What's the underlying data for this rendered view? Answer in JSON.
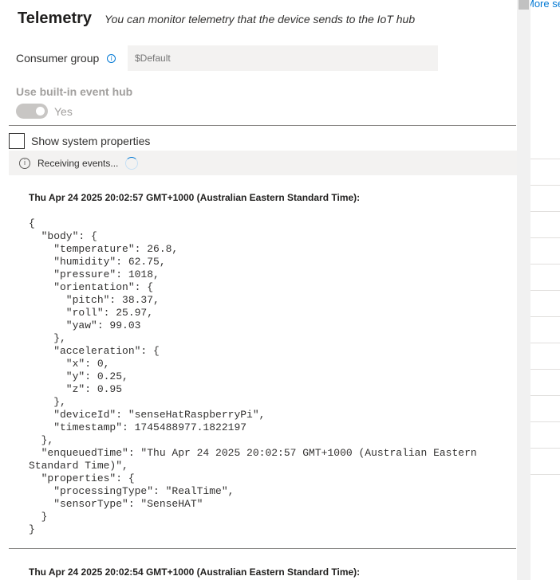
{
  "header": {
    "title": "Telemetry",
    "subtitle": "You can monitor telemetry that the device sends to the IoT hub"
  },
  "consumer_group": {
    "label": "Consumer group",
    "info_icon": "info-icon",
    "placeholder": "$Default"
  },
  "builtin_event_hub": {
    "label": "Use built-in event hub",
    "toggle_text": "Yes",
    "enabled": true
  },
  "system_properties": {
    "label": "Show system properties",
    "checked": false
  },
  "status": {
    "icon": "info-icon",
    "text": "Receiving events..."
  },
  "events": [
    {
      "timestamp": "Thu Apr 24 2025 20:02:57 GMT+1000 (Australian Eastern Standard Time):",
      "json": "{\n  \"body\": {\n    \"temperature\": 26.8,\n    \"humidity\": 62.75,\n    \"pressure\": 1018,\n    \"orientation\": {\n      \"pitch\": 38.37,\n      \"roll\": 25.97,\n      \"yaw\": 99.03\n    },\n    \"acceleration\": {\n      \"x\": 0,\n      \"y\": 0.25,\n      \"z\": 0.95\n    },\n    \"deviceId\": \"senseHatRaspberryPi\",\n    \"timestamp\": 1745488977.1822197\n  },\n  \"enqueuedTime\": \"Thu Apr 24 2025 20:02:57 GMT+1000 (Australian Eastern\nStandard Time)\",\n  \"properties\": {\n    \"processingType\": \"RealTime\",\n    \"sensorType\": \"SenseHAT\"\n  }\n}"
    },
    {
      "timestamp": "Thu Apr 24 2025 20:02:54 GMT+1000 (Australian Eastern Standard Time):"
    }
  ],
  "right_pane": {
    "link_text": "More se"
  },
  "colors": {
    "accent": "#0078d4",
    "status_bar_bg": "#f3f2f1",
    "disabled_text": "#a19f9d"
  }
}
